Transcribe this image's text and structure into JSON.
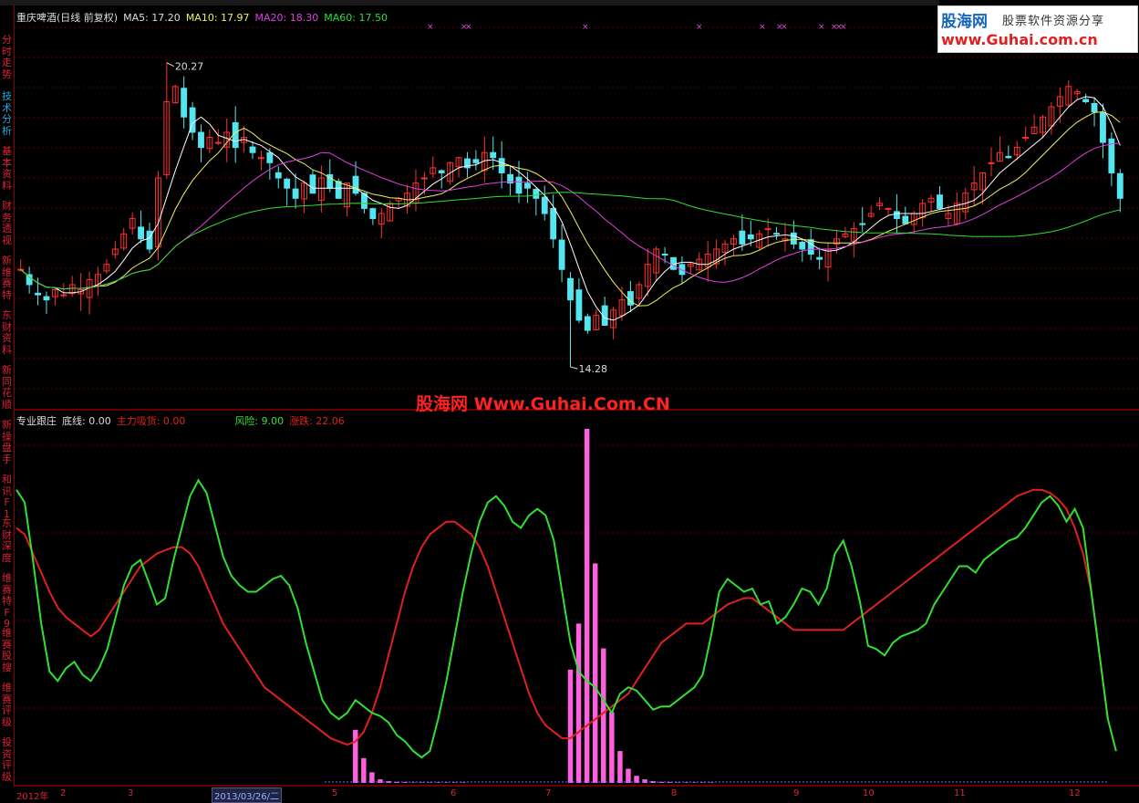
{
  "stock": {
    "name_line": "重庆啤酒(日线 前复权)",
    "ma5": "MA5: 17.20",
    "ma10": "MA10: 17.97",
    "ma20": "MA20: 18.30",
    "ma60": "MA60: 17.50",
    "high_label": "20.27",
    "low_label": "14.28"
  },
  "indicator": {
    "name": "专业跟庄",
    "base": "底线: 0.00",
    "main_absorb": "主力吸货: 0.00",
    "risk": "风险: 9.00",
    "change": "涨跌: 22.06"
  },
  "watermark": "股海网 Www.Guhai.Com.CN",
  "logo": {
    "name": "股海网",
    "tagline": "股票软件资源分享",
    "url": "www.Guhai.com.cn"
  },
  "sidebar": [
    {
      "label": "分时走势",
      "active": false
    },
    {
      "label": "技术分析",
      "active": true
    },
    {
      "label": "基本资料",
      "active": false
    },
    {
      "label": "财务透视",
      "active": false
    },
    {
      "label": "新维赛特",
      "active": false
    },
    {
      "label": "东财资料",
      "active": false
    },
    {
      "label": "新同花顺",
      "active": false
    },
    {
      "label": "新操盘手",
      "active": false
    },
    {
      "label": "和讯F1",
      "active": false
    },
    {
      "label": "东财深度",
      "active": false
    },
    {
      "label": "维赛特F9",
      "active": false
    },
    {
      "label": "维赛股搜",
      "active": false
    },
    {
      "label": "维赛评级",
      "active": false
    },
    {
      "label": "投资评级",
      "active": false
    }
  ],
  "dates": [
    {
      "label": "2012年",
      "selected": false
    },
    {
      "label": "2",
      "selected": false
    },
    {
      "label": "3",
      "selected": false
    },
    {
      "label": "2013/03/26/二",
      "selected": true
    },
    {
      "label": "5",
      "selected": false
    },
    {
      "label": "6",
      "selected": false
    },
    {
      "label": "7",
      "selected": false
    },
    {
      "label": "8",
      "selected": false
    },
    {
      "label": "9",
      "selected": false
    },
    {
      "label": "10",
      "selected": false
    },
    {
      "label": "11",
      "selected": false
    },
    {
      "label": "12",
      "selected": false
    }
  ],
  "colors": {
    "up": "#ff3030",
    "down": "#54e6f0",
    "ma5": "#ffffff",
    "ma10": "#f0f060",
    "ma20": "#e040e0",
    "ma60": "#30e030",
    "ind_green": "#30e030",
    "ind_red": "#e02020",
    "bars": "#ff60e0"
  },
  "chart_data": [
    {
      "type": "candlestick",
      "title": "重庆啤酒(日线 前复权)",
      "ylim": [
        13.6,
        21.0
      ],
      "high": 20.27,
      "low": 14.28,
      "closes": [
        16.2,
        15.9,
        15.7,
        15.6,
        15.8,
        15.7,
        15.9,
        15.8,
        16.0,
        16.1,
        16.3,
        16.6,
        16.9,
        17.2,
        16.8,
        16.6,
        18.0,
        19.5,
        19.8,
        19.2,
        18.9,
        18.6,
        18.8,
        18.7,
        18.9,
        18.6,
        18.8,
        18.5,
        18.4,
        18.3,
        18.0,
        17.8,
        17.6,
        17.9,
        17.7,
        18.0,
        17.8,
        17.6,
        17.9,
        17.7,
        17.4,
        17.2,
        17.3,
        17.5,
        17.6,
        17.7,
        17.9,
        18.0,
        18.2,
        18.1,
        18.3,
        18.4,
        18.2,
        18.3,
        18.5,
        18.4,
        18.1,
        17.9,
        17.7,
        17.8,
        17.6,
        17.3,
        16.8,
        16.2,
        15.6,
        15.2,
        15.0,
        15.3,
        15.1,
        15.4,
        15.6,
        15.5,
        15.9,
        16.3,
        16.6,
        16.5,
        16.2,
        16.1,
        16.3,
        16.4,
        16.5,
        16.6,
        16.7,
        16.8,
        16.7,
        16.8,
        16.9,
        17.0,
        16.9,
        16.8,
        16.7,
        16.6,
        16.5,
        16.4,
        16.6,
        16.8,
        16.9,
        17.0,
        17.1,
        17.3,
        17.5,
        17.4,
        17.2,
        17.1,
        17.3,
        17.5,
        17.6,
        17.4,
        17.3,
        17.5,
        17.7,
        17.9,
        18.1,
        18.3,
        18.5,
        18.4,
        18.6,
        18.8,
        19.0,
        19.2,
        19.4,
        19.6,
        19.8,
        19.7,
        19.5,
        19.3,
        18.7,
        18.1,
        17.6
      ],
      "ma_labels": [
        "MA5: 17.20",
        "MA10: 17.97",
        "MA20: 18.30",
        "MA60: 17.50"
      ]
    },
    {
      "type": "line",
      "title": "专业跟庄",
      "ylim": [
        0,
        100
      ],
      "series": [
        {
          "name": "风险",
          "values": [
            92,
            88,
            70,
            50,
            35,
            32,
            36,
            38,
            34,
            32,
            36,
            42,
            52,
            62,
            68,
            70,
            63,
            56,
            58,
            70,
            80,
            90,
            95,
            91,
            81,
            71,
            65,
            62,
            60,
            60,
            62,
            64,
            65,
            62,
            55,
            44,
            35,
            26,
            22,
            20,
            22,
            26,
            24,
            22,
            21,
            19,
            15,
            13,
            10,
            8,
            10,
            20,
            32,
            46,
            60,
            72,
            82,
            88,
            90,
            87,
            82,
            80,
            84,
            86,
            84,
            76,
            60,
            44,
            35,
            32,
            30,
            26,
            22,
            28,
            30,
            29,
            26,
            23,
            24,
            24,
            26,
            28,
            30,
            34,
            46,
            60,
            64,
            62,
            60,
            61,
            56,
            57,
            50,
            52,
            56,
            61,
            60,
            56,
            61,
            72,
            76,
            68,
            57,
            43,
            42,
            40,
            44,
            46,
            47,
            48,
            50,
            56,
            60,
            64,
            68,
            68,
            66,
            70,
            72,
            74,
            76,
            77,
            80,
            84,
            88,
            90,
            87,
            82,
            86,
            80,
            60,
            40,
            20,
            10
          ]
        },
        {
          "name": "涨跌",
          "values": [
            80,
            78,
            72,
            66,
            60,
            55,
            52,
            50,
            48,
            46,
            48,
            52,
            56,
            60,
            64,
            68,
            70,
            72,
            73,
            74,
            74,
            72,
            68,
            62,
            56,
            50,
            46,
            42,
            38,
            34,
            30,
            28,
            26,
            24,
            22,
            20,
            18,
            16,
            14,
            13,
            12,
            13,
            16,
            22,
            30,
            40,
            50,
            60,
            68,
            74,
            78,
            80,
            82,
            82,
            80,
            78,
            74,
            68,
            60,
            52,
            44,
            36,
            28,
            22,
            18,
            16,
            14,
            14,
            16,
            18,
            20,
            22,
            24,
            26,
            28,
            32,
            36,
            40,
            44,
            46,
            48,
            50,
            50,
            50,
            52,
            54,
            56,
            57,
            58,
            58,
            56,
            54,
            52,
            50,
            48,
            48,
            48,
            48,
            48,
            48,
            48,
            50,
            52,
            54,
            56,
            58,
            60,
            62,
            64,
            66,
            68,
            70,
            72,
            74,
            76,
            78,
            80,
            82,
            84,
            86,
            88,
            90,
            91,
            92,
            92,
            91,
            89,
            86,
            80,
            72,
            60,
            40,
            20
          ]
        }
      ],
      "bars": {
        "name": "主力吸货",
        "values": [
          0,
          0,
          0,
          0,
          0,
          0,
          0,
          0,
          0,
          0,
          0,
          0,
          0,
          0,
          0,
          0,
          0,
          0,
          0,
          0,
          0,
          0,
          0,
          0,
          0,
          0,
          0,
          0,
          0,
          0,
          0,
          0,
          0,
          0,
          0,
          0,
          0,
          0,
          0,
          0,
          0,
          15,
          7,
          3,
          1,
          0.5,
          0.3,
          0.2,
          0.1,
          0.1,
          0.1,
          0.1,
          0.1,
          0.1,
          0.1,
          0,
          0,
          0,
          0,
          0,
          0,
          0,
          0,
          0,
          0,
          0,
          0,
          32,
          45,
          100,
          62,
          38,
          20,
          9,
          4,
          2,
          1,
          0.5,
          0.3,
          0.2,
          0.1,
          0.1,
          0.1,
          0.1,
          0.1,
          0,
          0,
          0,
          0,
          0,
          0,
          0,
          0,
          0,
          0,
          0,
          0,
          0,
          0,
          0,
          0,
          0,
          0,
          0,
          0,
          0,
          0,
          0,
          0,
          0,
          0,
          0,
          0,
          0,
          0,
          0,
          0,
          0,
          0,
          0,
          0,
          0,
          0,
          0,
          0,
          0,
          0,
          0,
          0,
          0,
          0,
          0,
          0
        ]
      }
    }
  ]
}
